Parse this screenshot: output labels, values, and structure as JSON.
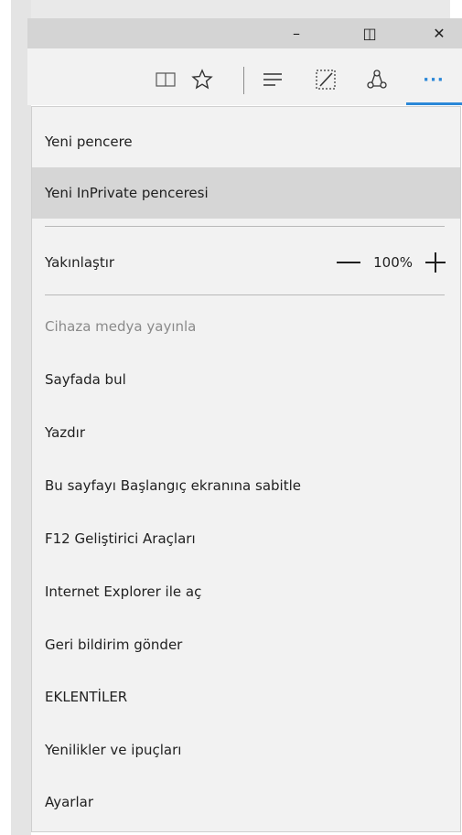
{
  "window": {
    "minimize_glyph": "–",
    "restore_glyph": "◫",
    "close_glyph": "✕"
  },
  "toolbar": {
    "icons": [
      "reading-view-icon",
      "favorite-star-icon",
      "hub-icon",
      "web-note-icon",
      "share-icon",
      "more-icon"
    ],
    "more_glyph": "···",
    "accent": "#2b88d8"
  },
  "menu": {
    "new_window": "Yeni pencere",
    "new_inprivate": "Yeni InPrivate penceresi",
    "zoom_label": "Yakınlaştır",
    "zoom_value": "100%",
    "cast": "Cihaza medya yayınla",
    "find": "Sayfada bul",
    "print": "Yazdır",
    "pin": "Bu sayfayı Başlangıç ekranına sabitle",
    "devtools": "F12 Geliştirici Araçları",
    "ie": "Internet Explorer ile aç",
    "feedback": "Geri bildirim gönder",
    "extensions": "EKLENTİLER",
    "tips": "Yenilikler ve ipuçları",
    "settings": "Ayarlar"
  }
}
